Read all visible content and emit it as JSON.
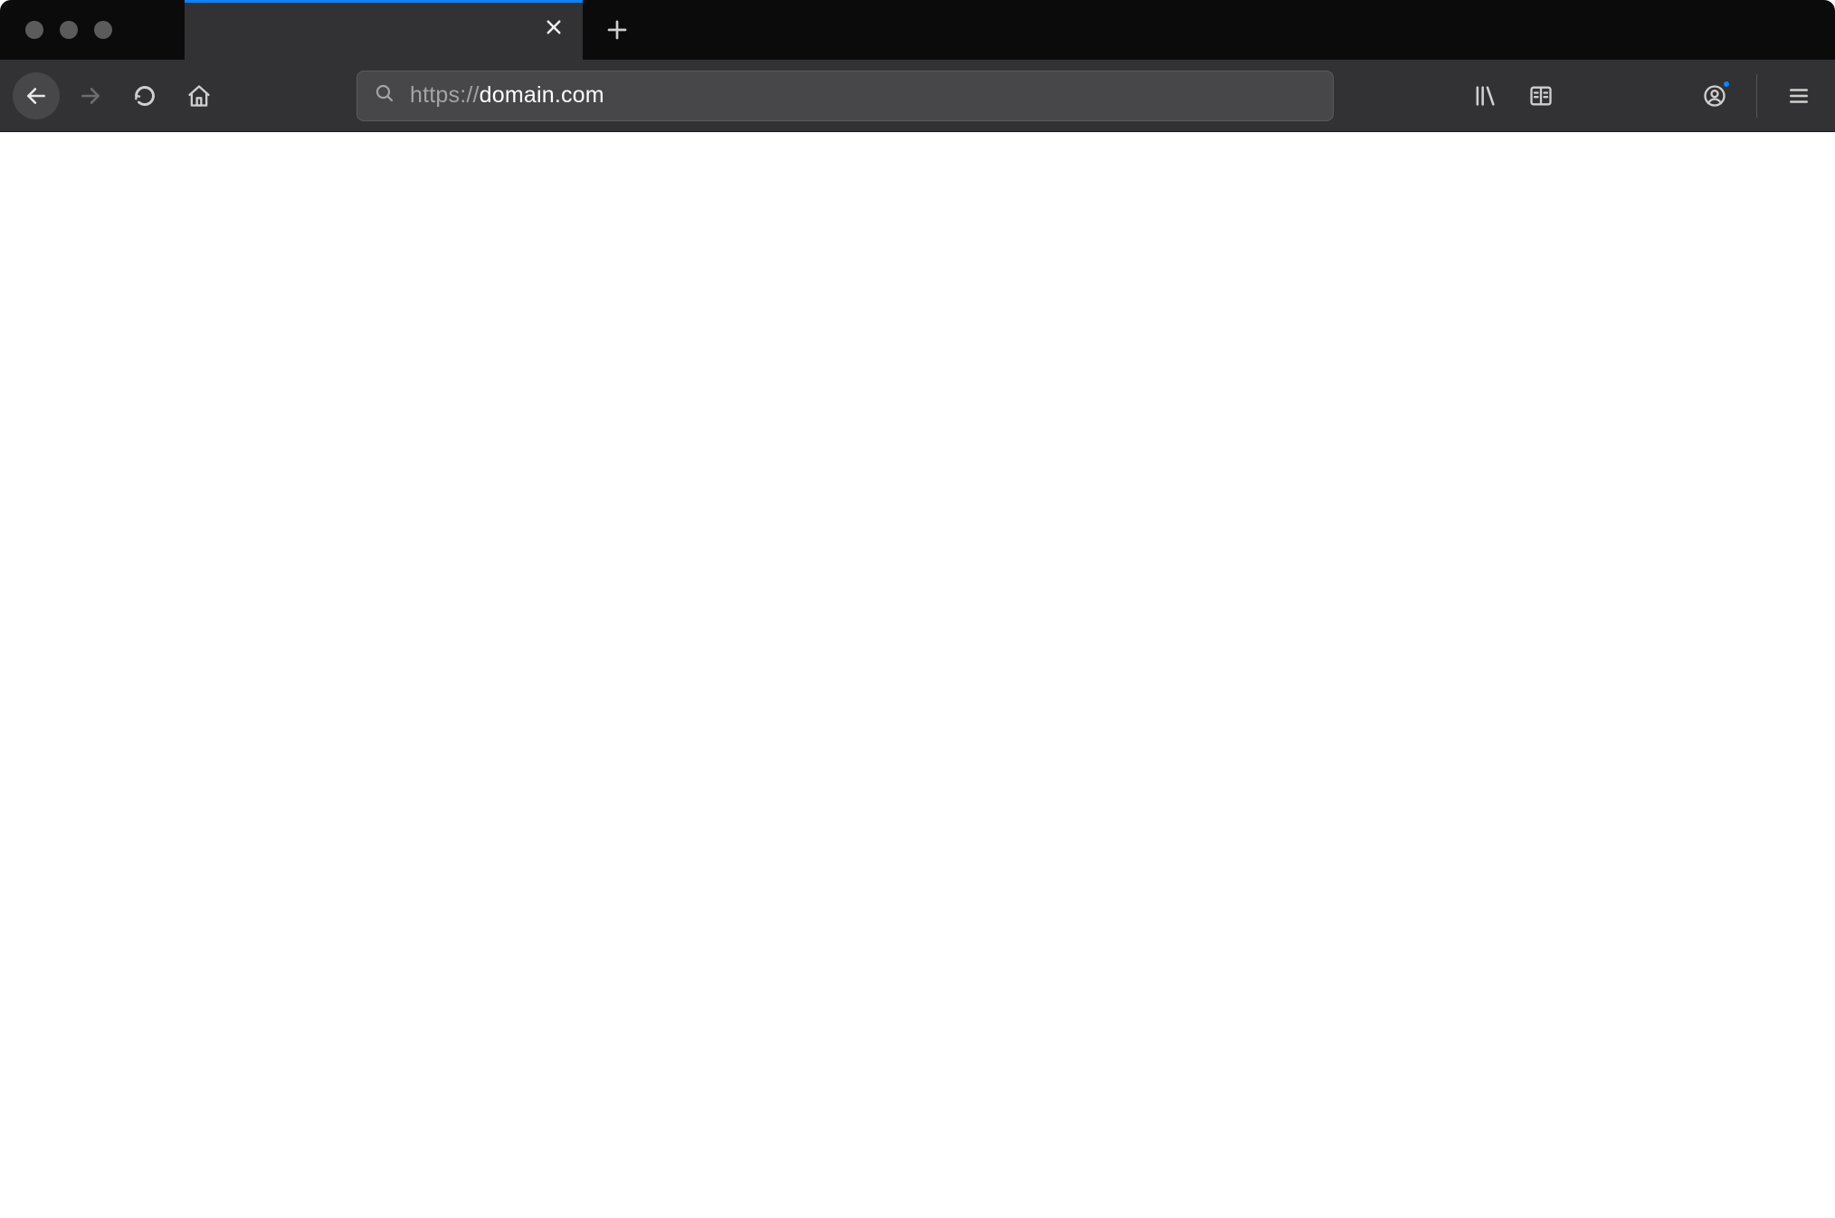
{
  "colors": {
    "tabstrip_bg": "#0b0b0b",
    "toolbar_bg": "#323234",
    "accent": "#0a84ff",
    "address_bg": "#474749",
    "inactive_text": "#a4a4a6"
  },
  "tabs": [
    {
      "title": "",
      "active": true
    }
  ],
  "addressbar": {
    "protocol": "https://",
    "host": "domain.com",
    "full": "https://domain.com"
  },
  "icons": {
    "back": "back-icon",
    "forward": "forward-icon",
    "reload": "reload-icon",
    "home": "home-icon",
    "search": "search-icon",
    "library": "library-icon",
    "reader": "reader-view-icon",
    "profile": "profile-icon",
    "menu": "hamburger-menu-icon",
    "close": "close-icon",
    "plus": "plus-icon"
  }
}
